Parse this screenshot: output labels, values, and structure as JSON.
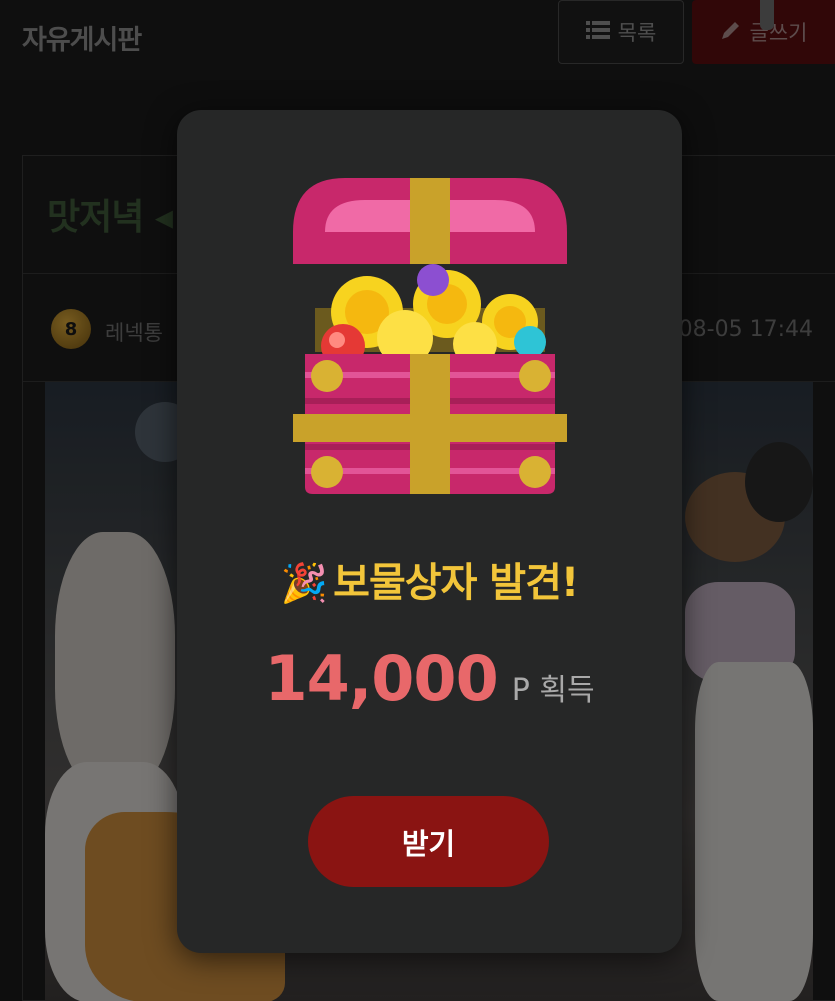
{
  "header": {
    "board_title": "자유게시판",
    "list_button": "목록",
    "write_button": "글쓰기"
  },
  "post": {
    "title": "맛저녁 ◂",
    "author": {
      "name": "레넥통",
      "level": "8"
    },
    "date": "08-05 17:44"
  },
  "modal": {
    "title": "보물상자 발견!",
    "title_emoji": "🎉",
    "reward_amount": "14,000",
    "reward_unit": "P 획득",
    "claim_button": "받기",
    "icon": "treasure-chest-icon"
  },
  "colors": {
    "modal_bg": "#262727",
    "title": "#f2c53a",
    "amount": "#e8686a",
    "claim_button": "#8a1412",
    "write_button": "#5a0d10"
  }
}
